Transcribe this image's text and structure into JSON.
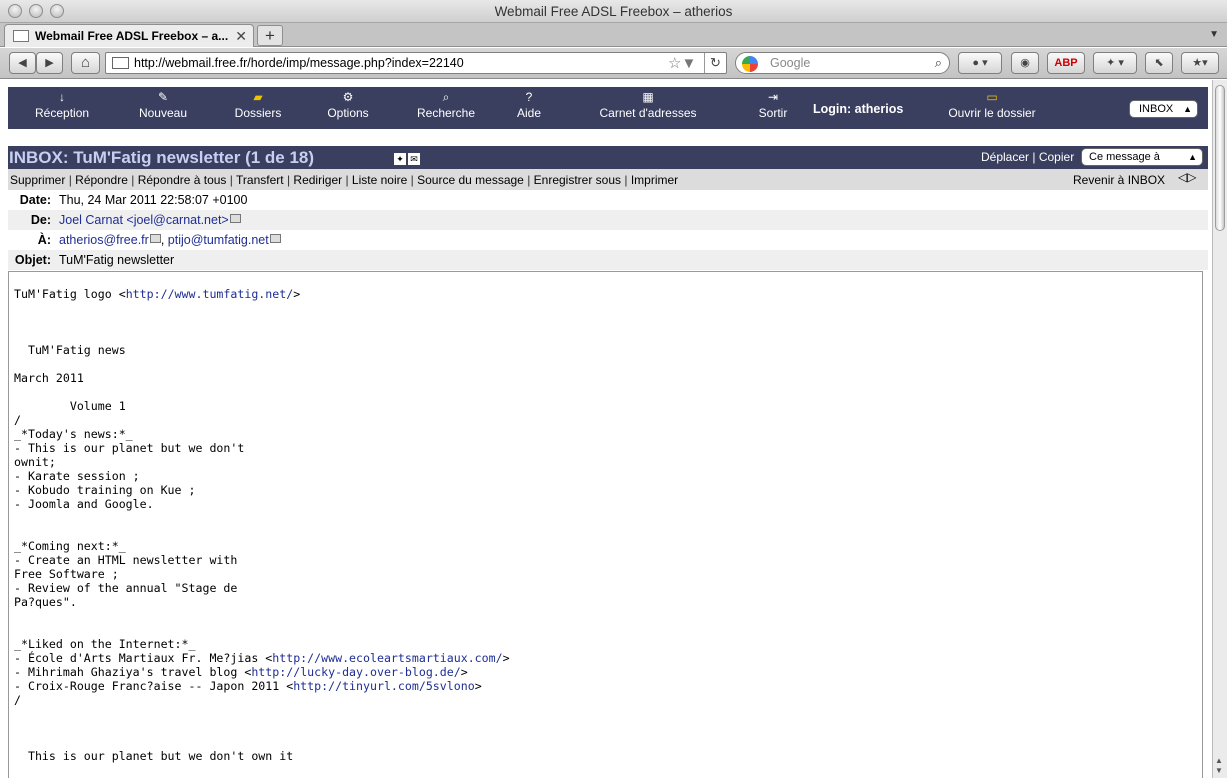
{
  "window": {
    "title": "Webmail Free ADSL Freebox – atherios"
  },
  "tab": {
    "title": "Webmail Free ADSL Freebox – a...",
    "close": "✕",
    "new": "+"
  },
  "navbar": {
    "back": "◀",
    "forward": "▶",
    "home": "⌂",
    "url": "http://webmail.free.fr/horde/imp/message.php?index=22140",
    "bookmark_star": "☆▼",
    "reload": "↻",
    "search_placeholder": "Google",
    "search_icon": "⌕"
  },
  "horde": {
    "nav": [
      {
        "label": "Réception",
        "icon": "↓"
      },
      {
        "label": "Nouveau",
        "icon": "✎"
      },
      {
        "label": "Dossiers",
        "icon": "▰"
      },
      {
        "label": "Options",
        "icon": "⚙"
      },
      {
        "label": "Recherche",
        "icon": "⌕"
      },
      {
        "label": "Aide",
        "icon": "?"
      },
      {
        "label": "Carnet d'adresses",
        "icon": "▦"
      },
      {
        "label": "Sortir",
        "icon": "⇥"
      }
    ],
    "login": "Login: atherios",
    "open_folder": {
      "label": "Ouvrir le dossier",
      "icon": "▭"
    },
    "mailbox_select": "INBOX"
  },
  "message_header": {
    "title": "INBOX: TuM'Fatig newsletter (1 de 18)",
    "move": "Déplacer",
    "sep": "|",
    "copy": "Copier",
    "target_select": "Ce message à"
  },
  "actions": {
    "items": [
      "Supprimer",
      "Répondre",
      "Répondre à tous",
      "Transfert",
      "Rediriger",
      "Liste noire",
      "Source du message",
      "Enregistrer sous",
      "Imprimer"
    ],
    "back_to_inbox": "Revenir à INBOX",
    "prev_next": "◁▷"
  },
  "headers": {
    "date_label": "Date:",
    "date": "Thu, 24 Mar 2011 22:58:07 +0100",
    "from_label": "De:",
    "from": "Joel Carnat <joel@carnat.net>",
    "to_label": "À:",
    "to1": "atherios@free.fr",
    "to2": "ptijo@tumfatig.net",
    "subject_label": "Objet:",
    "subject": "TuM'Fatig newsletter"
  },
  "body": {
    "line1_pre": "TuM'Fatig logo <",
    "line1_link": "http://www.tumfatig.net/",
    "line1_post": ">",
    "block1": "\n\n\n  TuM'Fatig news\n\nMarch 2011\n\n        Volume 1\n/\n_*Today's news:*_\n- This is our planet but we don't\nownit;\n- Karate session ;\n- Kobudo training on Kue ;\n- Joomla and Google.\n\n\n_*Coming next:*_\n- Create an HTML newsletter with\nFree Software ;\n- Review of the annual \"Stage de\nPa?ques\".\n\n\n_*Liked on the Internet:*_",
    "like1_pre": "- École d'Arts Martiaux Fr. Me?jias <",
    "like1_link": "http://www.ecoleartsmartiaux.com/",
    "like1_post": ">",
    "like2_pre": "- Mihrimah Ghaziya's travel blog <",
    "like2_link": "http://lucky-day.over-blog.de/",
    "like2_post": ">",
    "like3_pre": "- Croix-Rouge Franc?aise -- Japon 2011 <",
    "like3_link": "http://tinyurl.com/5svlono",
    "like3_post": ">",
    "block2": "/\n\n\n\n  This is our planet but we don't own it"
  }
}
